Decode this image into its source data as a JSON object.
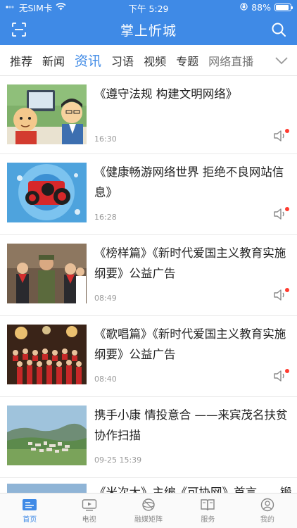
{
  "status_bar": {
    "carrier": "无SIM卡",
    "time": "下午 5:29",
    "battery_percent": "88%",
    "battery_level": 0.88
  },
  "header": {
    "title": "掌上忻城",
    "scan_icon": "scan-icon",
    "search_icon": "search-icon"
  },
  "tabs": [
    {
      "label": "推荐",
      "active": false
    },
    {
      "label": "新闻",
      "active": false
    },
    {
      "label": "资讯",
      "active": true
    },
    {
      "label": "习语",
      "active": false
    },
    {
      "label": "视频",
      "active": false
    },
    {
      "label": "专题",
      "active": false
    },
    {
      "label": "网络直播",
      "active": false
    }
  ],
  "news": [
    {
      "title": "《遵守法规 构建文明网络》",
      "time": "16:30",
      "has_audio": true
    },
    {
      "title": "《健康畅游网络世界  拒绝不良网站信息》",
      "time": "16:28",
      "has_audio": true
    },
    {
      "title": "《榜样篇》《新时代爱国主义教育实施纲要》公益广告",
      "time": "08:49",
      "has_audio": true
    },
    {
      "title": "《歌唱篇》《新时代爱国主义教育实施纲要》公益广告",
      "time": "08:40",
      "has_audio": true
    },
    {
      "title": "携手小康 情投意合 ——来宾茂名扶贫协作扫描",
      "time": "09-25 15:39",
      "has_audio": false
    }
  ],
  "partial_news_title": "《米次大》主编《可协网》首言……锻",
  "bottom_nav": [
    {
      "label": "首页",
      "icon": "home-icon",
      "active": true
    },
    {
      "label": "电视",
      "icon": "tv-icon",
      "active": false
    },
    {
      "label": "融媒矩阵",
      "icon": "media-matrix-icon",
      "active": false
    },
    {
      "label": "服务",
      "icon": "services-icon",
      "active": false
    },
    {
      "label": "我的",
      "icon": "profile-icon",
      "active": false
    }
  ],
  "colors": {
    "brand": "#3f8ae6",
    "notification_dot": "#ff3b30"
  }
}
